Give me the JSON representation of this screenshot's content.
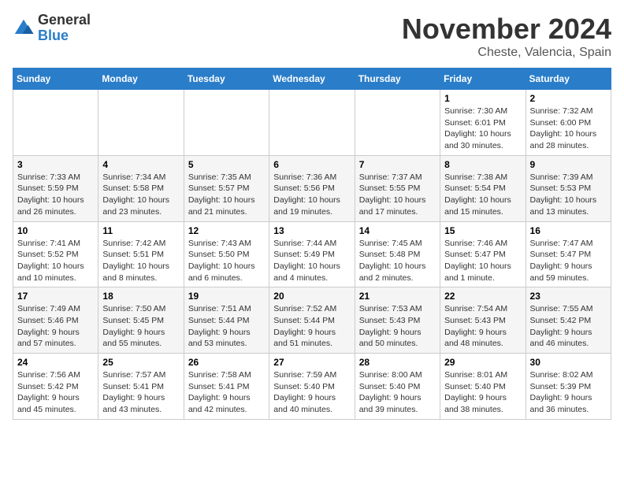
{
  "header": {
    "logo_general": "General",
    "logo_blue": "Blue",
    "month_title": "November 2024",
    "location": "Cheste, Valencia, Spain"
  },
  "weekdays": [
    "Sunday",
    "Monday",
    "Tuesday",
    "Wednesday",
    "Thursday",
    "Friday",
    "Saturday"
  ],
  "weeks": [
    [
      {
        "day": "",
        "info": ""
      },
      {
        "day": "",
        "info": ""
      },
      {
        "day": "",
        "info": ""
      },
      {
        "day": "",
        "info": ""
      },
      {
        "day": "",
        "info": ""
      },
      {
        "day": "1",
        "info": "Sunrise: 7:30 AM\nSunset: 6:01 PM\nDaylight: 10 hours and 30 minutes."
      },
      {
        "day": "2",
        "info": "Sunrise: 7:32 AM\nSunset: 6:00 PM\nDaylight: 10 hours and 28 minutes."
      }
    ],
    [
      {
        "day": "3",
        "info": "Sunrise: 7:33 AM\nSunset: 5:59 PM\nDaylight: 10 hours and 26 minutes."
      },
      {
        "day": "4",
        "info": "Sunrise: 7:34 AM\nSunset: 5:58 PM\nDaylight: 10 hours and 23 minutes."
      },
      {
        "day": "5",
        "info": "Sunrise: 7:35 AM\nSunset: 5:57 PM\nDaylight: 10 hours and 21 minutes."
      },
      {
        "day": "6",
        "info": "Sunrise: 7:36 AM\nSunset: 5:56 PM\nDaylight: 10 hours and 19 minutes."
      },
      {
        "day": "7",
        "info": "Sunrise: 7:37 AM\nSunset: 5:55 PM\nDaylight: 10 hours and 17 minutes."
      },
      {
        "day": "8",
        "info": "Sunrise: 7:38 AM\nSunset: 5:54 PM\nDaylight: 10 hours and 15 minutes."
      },
      {
        "day": "9",
        "info": "Sunrise: 7:39 AM\nSunset: 5:53 PM\nDaylight: 10 hours and 13 minutes."
      }
    ],
    [
      {
        "day": "10",
        "info": "Sunrise: 7:41 AM\nSunset: 5:52 PM\nDaylight: 10 hours and 10 minutes."
      },
      {
        "day": "11",
        "info": "Sunrise: 7:42 AM\nSunset: 5:51 PM\nDaylight: 10 hours and 8 minutes."
      },
      {
        "day": "12",
        "info": "Sunrise: 7:43 AM\nSunset: 5:50 PM\nDaylight: 10 hours and 6 minutes."
      },
      {
        "day": "13",
        "info": "Sunrise: 7:44 AM\nSunset: 5:49 PM\nDaylight: 10 hours and 4 minutes."
      },
      {
        "day": "14",
        "info": "Sunrise: 7:45 AM\nSunset: 5:48 PM\nDaylight: 10 hours and 2 minutes."
      },
      {
        "day": "15",
        "info": "Sunrise: 7:46 AM\nSunset: 5:47 PM\nDaylight: 10 hours and 1 minute."
      },
      {
        "day": "16",
        "info": "Sunrise: 7:47 AM\nSunset: 5:47 PM\nDaylight: 9 hours and 59 minutes."
      }
    ],
    [
      {
        "day": "17",
        "info": "Sunrise: 7:49 AM\nSunset: 5:46 PM\nDaylight: 9 hours and 57 minutes."
      },
      {
        "day": "18",
        "info": "Sunrise: 7:50 AM\nSunset: 5:45 PM\nDaylight: 9 hours and 55 minutes."
      },
      {
        "day": "19",
        "info": "Sunrise: 7:51 AM\nSunset: 5:44 PM\nDaylight: 9 hours and 53 minutes."
      },
      {
        "day": "20",
        "info": "Sunrise: 7:52 AM\nSunset: 5:44 PM\nDaylight: 9 hours and 51 minutes."
      },
      {
        "day": "21",
        "info": "Sunrise: 7:53 AM\nSunset: 5:43 PM\nDaylight: 9 hours and 50 minutes."
      },
      {
        "day": "22",
        "info": "Sunrise: 7:54 AM\nSunset: 5:43 PM\nDaylight: 9 hours and 48 minutes."
      },
      {
        "day": "23",
        "info": "Sunrise: 7:55 AM\nSunset: 5:42 PM\nDaylight: 9 hours and 46 minutes."
      }
    ],
    [
      {
        "day": "24",
        "info": "Sunrise: 7:56 AM\nSunset: 5:42 PM\nDaylight: 9 hours and 45 minutes."
      },
      {
        "day": "25",
        "info": "Sunrise: 7:57 AM\nSunset: 5:41 PM\nDaylight: 9 hours and 43 minutes."
      },
      {
        "day": "26",
        "info": "Sunrise: 7:58 AM\nSunset: 5:41 PM\nDaylight: 9 hours and 42 minutes."
      },
      {
        "day": "27",
        "info": "Sunrise: 7:59 AM\nSunset: 5:40 PM\nDaylight: 9 hours and 40 minutes."
      },
      {
        "day": "28",
        "info": "Sunrise: 8:00 AM\nSunset: 5:40 PM\nDaylight: 9 hours and 39 minutes."
      },
      {
        "day": "29",
        "info": "Sunrise: 8:01 AM\nSunset: 5:40 PM\nDaylight: 9 hours and 38 minutes."
      },
      {
        "day": "30",
        "info": "Sunrise: 8:02 AM\nSunset: 5:39 PM\nDaylight: 9 hours and 36 minutes."
      }
    ]
  ]
}
